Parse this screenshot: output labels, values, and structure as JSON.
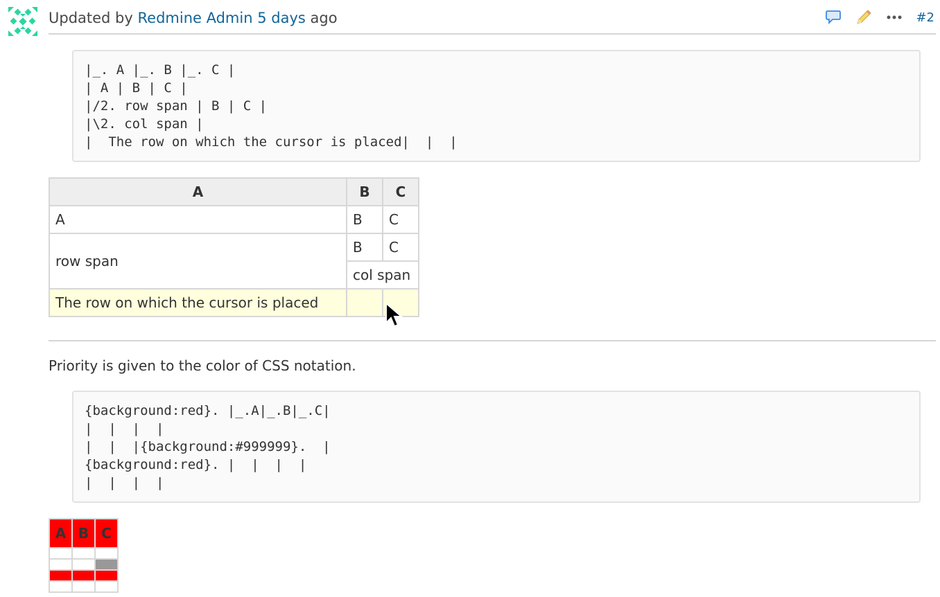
{
  "journal": {
    "prefix": "Updated by",
    "author": "Redmine Admin",
    "time_ago": "5 days",
    "suffix": "ago",
    "note_number": "#2",
    "actions": {
      "quote_icon": "speech-bubble-icon",
      "edit_icon": "pencil-icon",
      "more_icon": "ellipsis-icon"
    }
  },
  "code_block_1": "|_. A |_. B |_. C |\n| A | B | C |\n|/2. row span | B | C |\n|\\2. col span |\n|  The row on which the cursor is placed|  |  |",
  "table1": {
    "headers": [
      "A",
      "B",
      "C"
    ],
    "row1": [
      "A",
      "B",
      "C"
    ],
    "row2": [
      "row span",
      "B",
      "C"
    ],
    "row3": [
      "col span"
    ],
    "row4": [
      "The row on which the cursor is placed",
      "",
      ""
    ]
  },
  "paragraph": "Priority is given to the color of CSS notation.",
  "code_block_2": "{background:red}. |_.A|_.B|_.C|\n|  |  |  |\n|  |  |{background:#999999}.  |\n{background:red}. |  |  |  |\n|  |  |  |",
  "table2": {
    "headers": [
      "A",
      "B",
      "C"
    ],
    "header_bg": "#ff0000",
    "gray_cell_bg": "#999999",
    "red_row_bg": "#ff0000"
  },
  "colors": {
    "link": "#116699",
    "cursor_row": "#ffffdd",
    "pre_bg": "#fafafa",
    "table_border": "#d7d7d7"
  }
}
